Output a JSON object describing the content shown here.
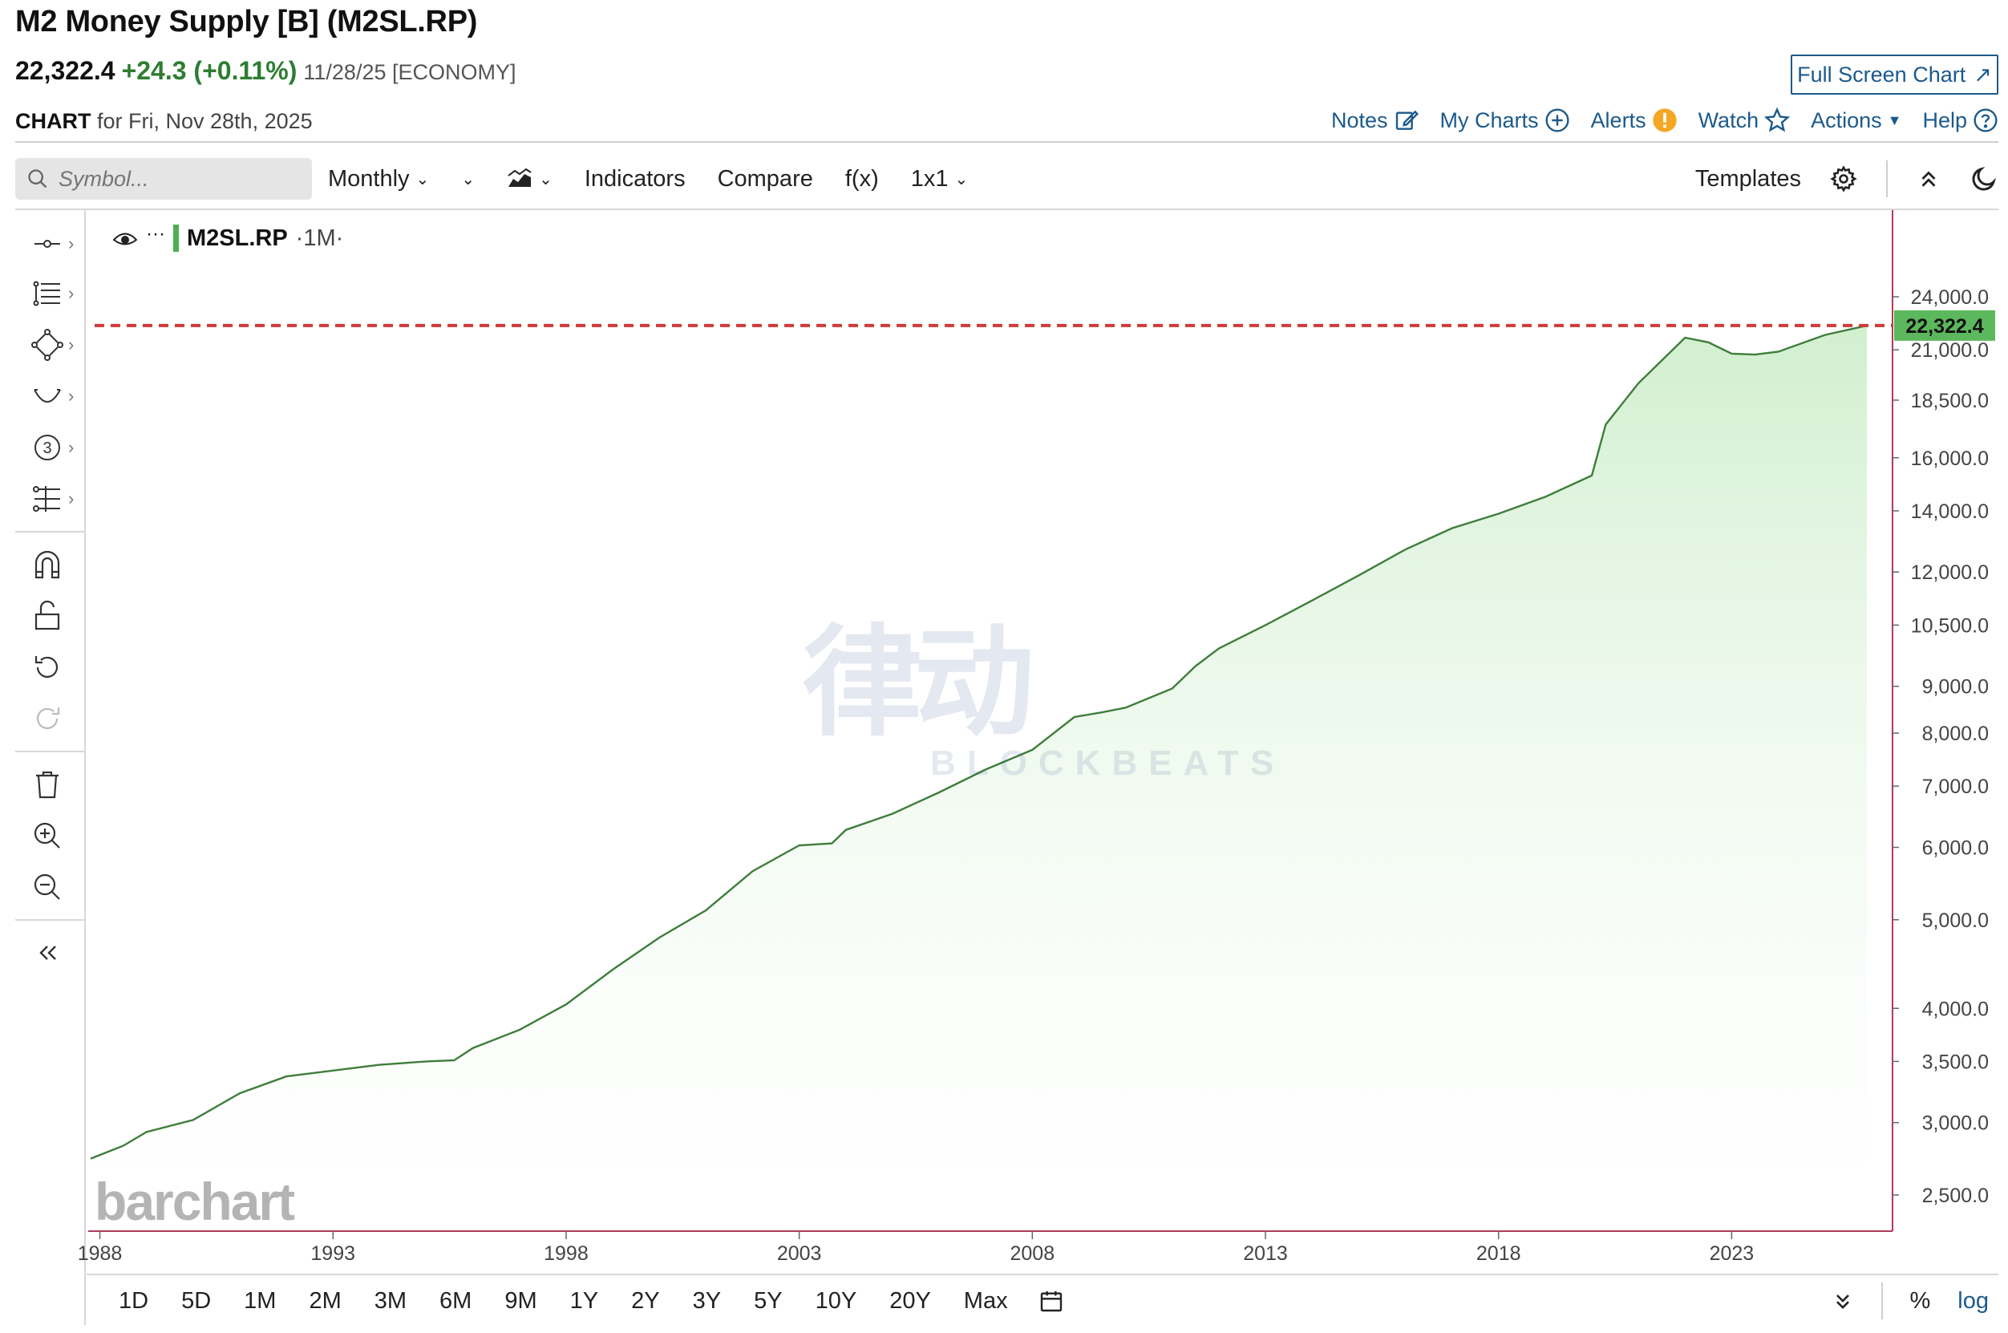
{
  "header": {
    "title": "M2 Money Supply [B] (M2SL.RP)",
    "last": "22,322.4",
    "change": "+24.3 (+0.11%)",
    "date_meta": "11/28/25 [ECONOMY]",
    "fullscreen_label": "Full Screen Chart",
    "chart_word": "CHART",
    "chart_date": "for Fri, Nov 28th, 2025"
  },
  "nav": {
    "notes": "Notes",
    "my_charts": "My Charts",
    "alerts": "Alerts",
    "watch": "Watch",
    "actions": "Actions",
    "help": "Help"
  },
  "toolbar": {
    "search_placeholder": "Symbol...",
    "interval": "Monthly",
    "indicators": "Indicators",
    "compare": "Compare",
    "fx": "f(x)",
    "layout": "1x1",
    "templates": "Templates"
  },
  "legend": {
    "symbol": "M2SL.RP",
    "period": "·1M·"
  },
  "watermark": {
    "cn": "律动",
    "en": "BLOCKBEATS"
  },
  "brand": "barchart",
  "ranges": [
    "1D",
    "5D",
    "1M",
    "2M",
    "3M",
    "6M",
    "9M",
    "1Y",
    "2Y",
    "3Y",
    "5Y",
    "10Y",
    "20Y",
    "Max"
  ],
  "bottom": {
    "percent": "%",
    "log": "log"
  },
  "colors": {
    "line": "#3e7d3a",
    "fill_top": "#cfeecd",
    "last_line": "#d03a3a",
    "last_badge": "#5cb85c",
    "link": "#1c5a8c",
    "axis_line": "#b03a5a"
  },
  "chart_data": {
    "type": "area",
    "scale": "log",
    "x_tick_labels": [
      "1988",
      "1993",
      "1998",
      "2003",
      "2008",
      "2013",
      "2018",
      "2023"
    ],
    "x_range": [
      1987.75,
      2026.45
    ],
    "y_tick_values": [
      2500,
      3000,
      3500,
      4000,
      5000,
      6000,
      7000,
      8000,
      9000,
      10500,
      12000,
      14000,
      16000,
      18500,
      21000,
      24000
    ],
    "y_tick_labels": [
      "2,500.0",
      "3,000.0",
      "3,500.0",
      "4,000.0",
      "5,000.0",
      "6,000.0",
      "7,000.0",
      "8,000.0",
      "9,000.0",
      "10,500.0",
      "12,000.0",
      "14,000.0",
      "16,000.0",
      "18,500.0",
      "21,000.0",
      "24,000.0"
    ],
    "last_value": 22322.4,
    "last_label": "22,322.4",
    "legend_position": "top-left",
    "grid": false,
    "series": [
      {
        "points": [
          [
            1987.8,
            2740
          ],
          [
            1988.5,
            2830
          ],
          [
            1989.0,
            2930
          ],
          [
            1990.0,
            3020
          ],
          [
            1991.0,
            3230
          ],
          [
            1992.0,
            3370
          ],
          [
            1993.0,
            3420
          ],
          [
            1994.0,
            3470
          ],
          [
            1995.0,
            3500
          ],
          [
            1995.6,
            3510
          ],
          [
            1996.0,
            3620
          ],
          [
            1997.0,
            3790
          ],
          [
            1998.0,
            4040
          ],
          [
            1999.0,
            4410
          ],
          [
            2000.0,
            4780
          ],
          [
            2001.0,
            5120
          ],
          [
            2002.0,
            5650
          ],
          [
            2003.0,
            6030
          ],
          [
            2003.7,
            6060
          ],
          [
            2004.0,
            6270
          ],
          [
            2005.0,
            6530
          ],
          [
            2006.0,
            6890
          ],
          [
            2007.0,
            7300
          ],
          [
            2008.0,
            7670
          ],
          [
            2008.9,
            8330
          ],
          [
            2009.5,
            8430
          ],
          [
            2010.0,
            8530
          ],
          [
            2011.0,
            8950
          ],
          [
            2011.5,
            9470
          ],
          [
            2012.0,
            9900
          ],
          [
            2013.0,
            10500
          ],
          [
            2014.0,
            11170
          ],
          [
            2015.0,
            11900
          ],
          [
            2016.0,
            12700
          ],
          [
            2017.0,
            13400
          ],
          [
            2018.0,
            13900
          ],
          [
            2019.0,
            14500
          ],
          [
            2020.0,
            15300
          ],
          [
            2020.3,
            17400
          ],
          [
            2021.0,
            19300
          ],
          [
            2022.0,
            21650
          ],
          [
            2022.5,
            21400
          ],
          [
            2023.0,
            20800
          ],
          [
            2023.5,
            20750
          ],
          [
            2024.0,
            20900
          ],
          [
            2025.0,
            21800
          ],
          [
            2025.9,
            22322.4
          ]
        ]
      }
    ]
  }
}
